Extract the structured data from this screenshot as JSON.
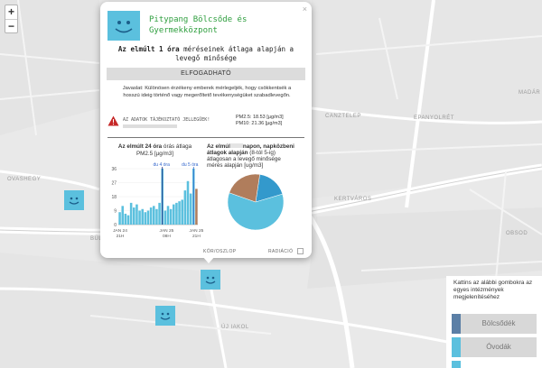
{
  "zoom": {
    "in_label": "+",
    "out_label": "−"
  },
  "map_labels": [
    {
      "id": "ovashegy",
      "text": "OVASHEGY"
    },
    {
      "id": "canztelep",
      "text": "CANZTELEP"
    },
    {
      "id": "epanyolret",
      "text": "EPANYOLRÉT"
    },
    {
      "id": "kertvaros",
      "text": "KERTVÁROS"
    },
    {
      "id": "madar",
      "text": "MADÁR"
    },
    {
      "id": "obsod",
      "text": "OBSOD"
    },
    {
      "id": "bul",
      "text": "BÜL"
    },
    {
      "id": "ujiakol",
      "text": "ÚJ IAKOL"
    }
  ],
  "popup": {
    "close": "×",
    "title": "Pitypang Bölcsőde és Gyermekközpont",
    "subtitle_bold": "Az elmúlt 1 óra",
    "subtitle_rest": " méréseinek átlaga alapján a levegő minősége",
    "rating": "ELFOGADHATÓ",
    "advice": "Javaslat: Különösen érzékeny emberek mérlegeljék, hogy csökkentsék a hosszú ideig történő vagy megerőltető tevékenységüket szabadlevegőn.",
    "warning_text": "AZ ADATOK TÁJÉKOZTATÓ JELLEGŰEK!",
    "pm25_value": "PM2.5: 18.53 [µg/m3]",
    "pm10_value": "PM10: 21.36 [µg/m3]",
    "chart1_title_bold": "Az elmúlt 24 óra",
    "chart1_title_rest": " órás átlaga",
    "chart1_unit": "PM2.5 [µg/m3]",
    "chart2_title_line1_a": "Az elmúl",
    "chart2_title_line1_b": "napon, napközbeni",
    "chart2_title_line2": "átlagok alapján",
    "chart2_title_line2b": " (8-tól 5-ig)",
    "chart2_title_line3": "átlagosan a levegő minősége",
    "chart2_title_line4": "mérés alapján [ug/m3]",
    "toggle_label": "KÖR/OSZLOP",
    "radiation_label": "RADIÁCIÓ"
  },
  "chart_data": [
    {
      "type": "bar",
      "title": "Az elmúlt 24 óra órás átlaga",
      "ylabel": "PM2.5 [µg/m3]",
      "yticks": [
        "36",
        "27",
        "18",
        "9",
        "0"
      ],
      "ylim": [
        0,
        36
      ],
      "xticks": [
        {
          "l1": "JAN 24",
          "l2": "21H"
        },
        {
          "l1": "JAN 25",
          "l2": "08H"
        },
        {
          "l1": "JAN 25",
          "l2": "21H"
        }
      ],
      "markers": [
        "du 4 óra",
        "du 5 óra"
      ],
      "values": [
        8,
        12,
        7,
        6,
        14,
        11,
        13,
        9,
        10,
        8,
        9,
        11,
        12,
        10,
        14,
        36,
        9,
        12,
        10,
        13,
        14,
        15,
        16,
        22,
        28,
        20,
        36,
        23
      ],
      "colors": {
        "bar": "#5bc0de",
        "highlight": "#1a237e",
        "marker": "#3366cc",
        "last": "#b07d5c"
      }
    },
    {
      "type": "pie",
      "slices": [
        {
          "value": 18,
          "color": "#3399cc"
        },
        {
          "value": 60,
          "color": "#5bc0de"
        },
        {
          "value": 22,
          "color": "#b07d5c"
        }
      ]
    }
  ],
  "legend": {
    "text": "Kattins az alábbi gombokra az egyes intézmények megjelenítéséhez",
    "items": [
      {
        "label": "Bölcsődék",
        "color": "#5b7fa6"
      },
      {
        "label": "Óvodák",
        "color": "#5bc0de"
      }
    ]
  }
}
